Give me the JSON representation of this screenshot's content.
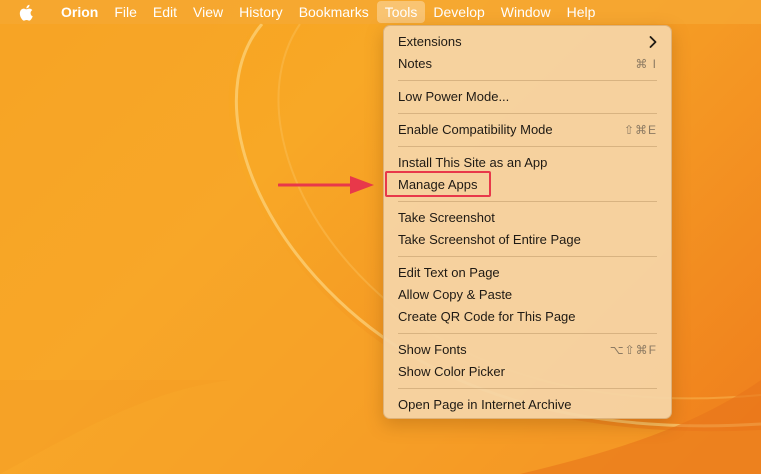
{
  "menubar": {
    "apple_icon": "apple-logo-icon",
    "app_name": "Orion",
    "items": [
      "File",
      "Edit",
      "View",
      "History",
      "Bookmarks",
      "Tools",
      "Develop",
      "Window",
      "Help"
    ],
    "active": "Tools"
  },
  "menu": {
    "extensions": {
      "label": "Extensions",
      "submenu_icon": "chevron-right-icon"
    },
    "notes": {
      "label": "Notes",
      "shortcut": "⌘ I"
    },
    "low_power": {
      "label": "Low Power Mode..."
    },
    "compat": {
      "label": "Enable Compatibility Mode",
      "shortcut": "⇧⌘E"
    },
    "install_app": {
      "label": "Install This Site as an App"
    },
    "manage_apps": {
      "label": "Manage Apps"
    },
    "screenshot": {
      "label": "Take Screenshot"
    },
    "screenshot_full": {
      "label": "Take Screenshot of Entire Page"
    },
    "edit_text": {
      "label": "Edit Text on Page"
    },
    "allow_copy": {
      "label": "Allow Copy & Paste"
    },
    "qr_code": {
      "label": "Create QR Code for This Page"
    },
    "show_fonts": {
      "label": "Show Fonts",
      "shortcut": "⌥⇧⌘F"
    },
    "color_picker": {
      "label": "Show Color Picker"
    },
    "archive": {
      "label": "Open Page in Internet Archive"
    }
  },
  "annotation": {
    "color": "#e8384a",
    "target": "Manage Apps"
  },
  "colors": {
    "wallpaper": "#f6a21f",
    "menu_background": "#f5d4a6"
  }
}
